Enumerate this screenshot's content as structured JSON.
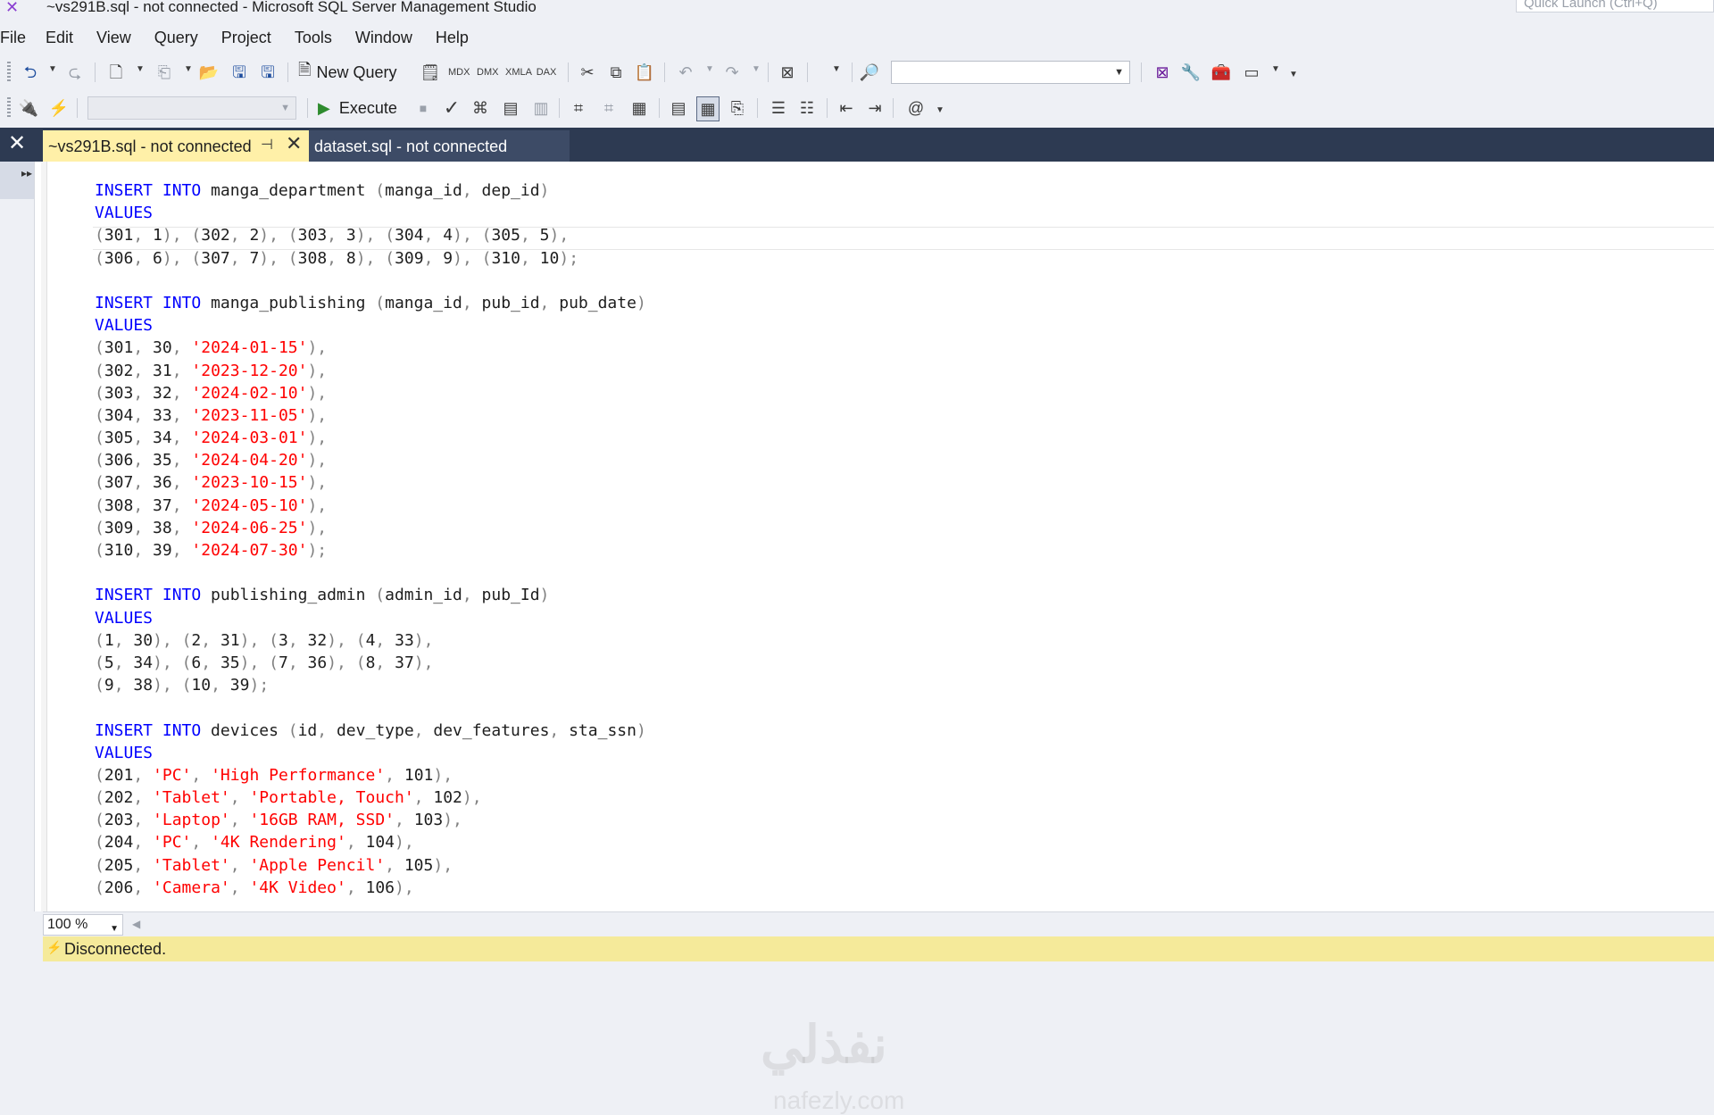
{
  "window": {
    "title": "~vs291B.sql - not connected - Microsoft SQL Server Management Studio",
    "quick_launch_placeholder": "Quick Launch (Ctrl+Q)"
  },
  "menu": [
    "File",
    "Edit",
    "View",
    "Query",
    "Project",
    "Tools",
    "Window",
    "Help"
  ],
  "toolbar": {
    "new_query_label": "New Query",
    "execute_label": "Execute"
  },
  "tabs": {
    "active_label": "~vs291B.sql - not connected",
    "inactive_label": "dataset.sql - not connected"
  },
  "editor": {
    "lines": [
      [
        {
          "t": "INSERT INTO ",
          "c": "kw"
        },
        {
          "t": "manga_department ",
          "c": ""
        },
        {
          "t": "(",
          "c": "pu"
        },
        {
          "t": "manga_id",
          "c": ""
        },
        {
          "t": ", ",
          "c": "pu"
        },
        {
          "t": "dep_id",
          "c": ""
        },
        {
          "t": ")",
          "c": "pu"
        }
      ],
      [
        {
          "t": "VALUES",
          "c": "kw"
        }
      ],
      [
        {
          "t": "(",
          "c": "pu"
        },
        {
          "t": "301",
          "c": ""
        },
        {
          "t": ", ",
          "c": "pu"
        },
        {
          "t": "1",
          "c": ""
        },
        {
          "t": "), (",
          "c": "pu"
        },
        {
          "t": "302",
          "c": ""
        },
        {
          "t": ", ",
          "c": "pu"
        },
        {
          "t": "2",
          "c": ""
        },
        {
          "t": "), (",
          "c": "pu"
        },
        {
          "t": "303",
          "c": ""
        },
        {
          "t": ", ",
          "c": "pu"
        },
        {
          "t": "3",
          "c": ""
        },
        {
          "t": "), (",
          "c": "pu"
        },
        {
          "t": "304",
          "c": ""
        },
        {
          "t": ", ",
          "c": "pu"
        },
        {
          "t": "4",
          "c": ""
        },
        {
          "t": "), (",
          "c": "pu"
        },
        {
          "t": "305",
          "c": ""
        },
        {
          "t": ", ",
          "c": "pu"
        },
        {
          "t": "5",
          "c": ""
        },
        {
          "t": "),",
          "c": "pu"
        }
      ],
      [
        {
          "t": "(",
          "c": "pu"
        },
        {
          "t": "306",
          "c": ""
        },
        {
          "t": ", ",
          "c": "pu"
        },
        {
          "t": "6",
          "c": ""
        },
        {
          "t": "), (",
          "c": "pu"
        },
        {
          "t": "307",
          "c": ""
        },
        {
          "t": ", ",
          "c": "pu"
        },
        {
          "t": "7",
          "c": ""
        },
        {
          "t": "), (",
          "c": "pu"
        },
        {
          "t": "308",
          "c": ""
        },
        {
          "t": ", ",
          "c": "pu"
        },
        {
          "t": "8",
          "c": ""
        },
        {
          "t": "), (",
          "c": "pu"
        },
        {
          "t": "309",
          "c": ""
        },
        {
          "t": ", ",
          "c": "pu"
        },
        {
          "t": "9",
          "c": ""
        },
        {
          "t": "), (",
          "c": "pu"
        },
        {
          "t": "310",
          "c": ""
        },
        {
          "t": ", ",
          "c": "pu"
        },
        {
          "t": "10",
          "c": ""
        },
        {
          "t": ");",
          "c": "pu"
        }
      ],
      [],
      [
        {
          "t": "INSERT INTO ",
          "c": "kw"
        },
        {
          "t": "manga_publishing ",
          "c": ""
        },
        {
          "t": "(",
          "c": "pu"
        },
        {
          "t": "manga_id",
          "c": ""
        },
        {
          "t": ", ",
          "c": "pu"
        },
        {
          "t": "pub_id",
          "c": ""
        },
        {
          "t": ", ",
          "c": "pu"
        },
        {
          "t": "pub_date",
          "c": ""
        },
        {
          "t": ")",
          "c": "pu"
        }
      ],
      [
        {
          "t": "VALUES",
          "c": "kw"
        }
      ],
      [
        {
          "t": "(",
          "c": "pu"
        },
        {
          "t": "301",
          "c": ""
        },
        {
          "t": ", ",
          "c": "pu"
        },
        {
          "t": "30",
          "c": ""
        },
        {
          "t": ", ",
          "c": "pu"
        },
        {
          "t": "'2024-01-15'",
          "c": "str"
        },
        {
          "t": "),",
          "c": "pu"
        }
      ],
      [
        {
          "t": "(",
          "c": "pu"
        },
        {
          "t": "302",
          "c": ""
        },
        {
          "t": ", ",
          "c": "pu"
        },
        {
          "t": "31",
          "c": ""
        },
        {
          "t": ", ",
          "c": "pu"
        },
        {
          "t": "'2023-12-20'",
          "c": "str"
        },
        {
          "t": "),",
          "c": "pu"
        }
      ],
      [
        {
          "t": "(",
          "c": "pu"
        },
        {
          "t": "303",
          "c": ""
        },
        {
          "t": ", ",
          "c": "pu"
        },
        {
          "t": "32",
          "c": ""
        },
        {
          "t": ", ",
          "c": "pu"
        },
        {
          "t": "'2024-02-10'",
          "c": "str"
        },
        {
          "t": "),",
          "c": "pu"
        }
      ],
      [
        {
          "t": "(",
          "c": "pu"
        },
        {
          "t": "304",
          "c": ""
        },
        {
          "t": ", ",
          "c": "pu"
        },
        {
          "t": "33",
          "c": ""
        },
        {
          "t": ", ",
          "c": "pu"
        },
        {
          "t": "'2023-11-05'",
          "c": "str"
        },
        {
          "t": "),",
          "c": "pu"
        }
      ],
      [
        {
          "t": "(",
          "c": "pu"
        },
        {
          "t": "305",
          "c": ""
        },
        {
          "t": ", ",
          "c": "pu"
        },
        {
          "t": "34",
          "c": ""
        },
        {
          "t": ", ",
          "c": "pu"
        },
        {
          "t": "'2024-03-01'",
          "c": "str"
        },
        {
          "t": "),",
          "c": "pu"
        }
      ],
      [
        {
          "t": "(",
          "c": "pu"
        },
        {
          "t": "306",
          "c": ""
        },
        {
          "t": ", ",
          "c": "pu"
        },
        {
          "t": "35",
          "c": ""
        },
        {
          "t": ", ",
          "c": "pu"
        },
        {
          "t": "'2024-04-20'",
          "c": "str"
        },
        {
          "t": "),",
          "c": "pu"
        }
      ],
      [
        {
          "t": "(",
          "c": "pu"
        },
        {
          "t": "307",
          "c": ""
        },
        {
          "t": ", ",
          "c": "pu"
        },
        {
          "t": "36",
          "c": ""
        },
        {
          "t": ", ",
          "c": "pu"
        },
        {
          "t": "'2023-10-15'",
          "c": "str"
        },
        {
          "t": "),",
          "c": "pu"
        }
      ],
      [
        {
          "t": "(",
          "c": "pu"
        },
        {
          "t": "308",
          "c": ""
        },
        {
          "t": ", ",
          "c": "pu"
        },
        {
          "t": "37",
          "c": ""
        },
        {
          "t": ", ",
          "c": "pu"
        },
        {
          "t": "'2024-05-10'",
          "c": "str"
        },
        {
          "t": "),",
          "c": "pu"
        }
      ],
      [
        {
          "t": "(",
          "c": "pu"
        },
        {
          "t": "309",
          "c": ""
        },
        {
          "t": ", ",
          "c": "pu"
        },
        {
          "t": "38",
          "c": ""
        },
        {
          "t": ", ",
          "c": "pu"
        },
        {
          "t": "'2024-06-25'",
          "c": "str"
        },
        {
          "t": "),",
          "c": "pu"
        }
      ],
      [
        {
          "t": "(",
          "c": "pu"
        },
        {
          "t": "310",
          "c": ""
        },
        {
          "t": ", ",
          "c": "pu"
        },
        {
          "t": "39",
          "c": ""
        },
        {
          "t": ", ",
          "c": "pu"
        },
        {
          "t": "'2024-07-30'",
          "c": "str"
        },
        {
          "t": ");",
          "c": "pu"
        }
      ],
      [],
      [
        {
          "t": "INSERT INTO ",
          "c": "kw"
        },
        {
          "t": "publishing_admin ",
          "c": ""
        },
        {
          "t": "(",
          "c": "pu"
        },
        {
          "t": "admin_id",
          "c": ""
        },
        {
          "t": ", ",
          "c": "pu"
        },
        {
          "t": "pub_Id",
          "c": ""
        },
        {
          "t": ")",
          "c": "pu"
        }
      ],
      [
        {
          "t": "VALUES",
          "c": "kw"
        }
      ],
      [
        {
          "t": "(",
          "c": "pu"
        },
        {
          "t": "1",
          "c": ""
        },
        {
          "t": ", ",
          "c": "pu"
        },
        {
          "t": "30",
          "c": ""
        },
        {
          "t": "), (",
          "c": "pu"
        },
        {
          "t": "2",
          "c": ""
        },
        {
          "t": ", ",
          "c": "pu"
        },
        {
          "t": "31",
          "c": ""
        },
        {
          "t": "), (",
          "c": "pu"
        },
        {
          "t": "3",
          "c": ""
        },
        {
          "t": ", ",
          "c": "pu"
        },
        {
          "t": "32",
          "c": ""
        },
        {
          "t": "), (",
          "c": "pu"
        },
        {
          "t": "4",
          "c": ""
        },
        {
          "t": ", ",
          "c": "pu"
        },
        {
          "t": "33",
          "c": ""
        },
        {
          "t": "),",
          "c": "pu"
        }
      ],
      [
        {
          "t": "(",
          "c": "pu"
        },
        {
          "t": "5",
          "c": ""
        },
        {
          "t": ", ",
          "c": "pu"
        },
        {
          "t": "34",
          "c": ""
        },
        {
          "t": "), (",
          "c": "pu"
        },
        {
          "t": "6",
          "c": ""
        },
        {
          "t": ", ",
          "c": "pu"
        },
        {
          "t": "35",
          "c": ""
        },
        {
          "t": "), (",
          "c": "pu"
        },
        {
          "t": "7",
          "c": ""
        },
        {
          "t": ", ",
          "c": "pu"
        },
        {
          "t": "36",
          "c": ""
        },
        {
          "t": "), (",
          "c": "pu"
        },
        {
          "t": "8",
          "c": ""
        },
        {
          "t": ", ",
          "c": "pu"
        },
        {
          "t": "37",
          "c": ""
        },
        {
          "t": "),",
          "c": "pu"
        }
      ],
      [
        {
          "t": "(",
          "c": "pu"
        },
        {
          "t": "9",
          "c": ""
        },
        {
          "t": ", ",
          "c": "pu"
        },
        {
          "t": "38",
          "c": ""
        },
        {
          "t": "), (",
          "c": "pu"
        },
        {
          "t": "10",
          "c": ""
        },
        {
          "t": ", ",
          "c": "pu"
        },
        {
          "t": "39",
          "c": ""
        },
        {
          "t": ");",
          "c": "pu"
        }
      ],
      [],
      [
        {
          "t": "INSERT INTO ",
          "c": "kw"
        },
        {
          "t": "devices ",
          "c": ""
        },
        {
          "t": "(",
          "c": "pu"
        },
        {
          "t": "id",
          "c": ""
        },
        {
          "t": ", ",
          "c": "pu"
        },
        {
          "t": "dev_type",
          "c": ""
        },
        {
          "t": ", ",
          "c": "pu"
        },
        {
          "t": "dev_features",
          "c": ""
        },
        {
          "t": ", ",
          "c": "pu"
        },
        {
          "t": "sta_ssn",
          "c": ""
        },
        {
          "t": ")",
          "c": "pu"
        }
      ],
      [
        {
          "t": "VALUES",
          "c": "kw"
        }
      ],
      [
        {
          "t": "(",
          "c": "pu"
        },
        {
          "t": "201",
          "c": ""
        },
        {
          "t": ", ",
          "c": "pu"
        },
        {
          "t": "'PC'",
          "c": "str"
        },
        {
          "t": ", ",
          "c": "pu"
        },
        {
          "t": "'High Performance'",
          "c": "str"
        },
        {
          "t": ", ",
          "c": "pu"
        },
        {
          "t": "101",
          "c": ""
        },
        {
          "t": "),",
          "c": "pu"
        }
      ],
      [
        {
          "t": "(",
          "c": "pu"
        },
        {
          "t": "202",
          "c": ""
        },
        {
          "t": ", ",
          "c": "pu"
        },
        {
          "t": "'Tablet'",
          "c": "str"
        },
        {
          "t": ", ",
          "c": "pu"
        },
        {
          "t": "'Portable, Touch'",
          "c": "str"
        },
        {
          "t": ", ",
          "c": "pu"
        },
        {
          "t": "102",
          "c": ""
        },
        {
          "t": "),",
          "c": "pu"
        }
      ],
      [
        {
          "t": "(",
          "c": "pu"
        },
        {
          "t": "203",
          "c": ""
        },
        {
          "t": ", ",
          "c": "pu"
        },
        {
          "t": "'Laptop'",
          "c": "str"
        },
        {
          "t": ", ",
          "c": "pu"
        },
        {
          "t": "'16GB RAM, SSD'",
          "c": "str"
        },
        {
          "t": ", ",
          "c": "pu"
        },
        {
          "t": "103",
          "c": ""
        },
        {
          "t": "),",
          "c": "pu"
        }
      ],
      [
        {
          "t": "(",
          "c": "pu"
        },
        {
          "t": "204",
          "c": ""
        },
        {
          "t": ", ",
          "c": "pu"
        },
        {
          "t": "'PC'",
          "c": "str"
        },
        {
          "t": ", ",
          "c": "pu"
        },
        {
          "t": "'4K Rendering'",
          "c": "str"
        },
        {
          "t": ", ",
          "c": "pu"
        },
        {
          "t": "104",
          "c": ""
        },
        {
          "t": "),",
          "c": "pu"
        }
      ],
      [
        {
          "t": "(",
          "c": "pu"
        },
        {
          "t": "205",
          "c": ""
        },
        {
          "t": ", ",
          "c": "pu"
        },
        {
          "t": "'Tablet'",
          "c": "str"
        },
        {
          "t": ", ",
          "c": "pu"
        },
        {
          "t": "'Apple Pencil'",
          "c": "str"
        },
        {
          "t": ", ",
          "c": "pu"
        },
        {
          "t": "105",
          "c": ""
        },
        {
          "t": "),",
          "c": "pu"
        }
      ],
      [
        {
          "t": "(",
          "c": "pu"
        },
        {
          "t": "206",
          "c": ""
        },
        {
          "t": ", ",
          "c": "pu"
        },
        {
          "t": "'Camera'",
          "c": "str"
        },
        {
          "t": ", ",
          "c": "pu"
        },
        {
          "t": "'4K Video'",
          "c": "str"
        },
        {
          "t": ", ",
          "c": "pu"
        },
        {
          "t": "106",
          "c": ""
        },
        {
          "t": "),",
          "c": "pu"
        }
      ]
    ]
  },
  "zoom": "100 %",
  "status": "Disconnected.",
  "watermark": {
    "main": "نفذلي",
    "sub": "nafezly.com"
  },
  "colors": {
    "keyword": "#0000ff",
    "string": "#ff0000",
    "punctuation": "#808080",
    "tab_active": "#fff0a8",
    "tabstrip": "#2d3a52",
    "statusbar": "#f5ea9a"
  },
  "icons": [
    "back-icon",
    "forward-icon",
    "new-project-icon",
    "open-file-icon",
    "save-icon",
    "save-all-icon",
    "cut-icon",
    "copy-icon",
    "paste-icon",
    "undo-icon",
    "redo-icon",
    "execute-icon",
    "parse-icon"
  ]
}
